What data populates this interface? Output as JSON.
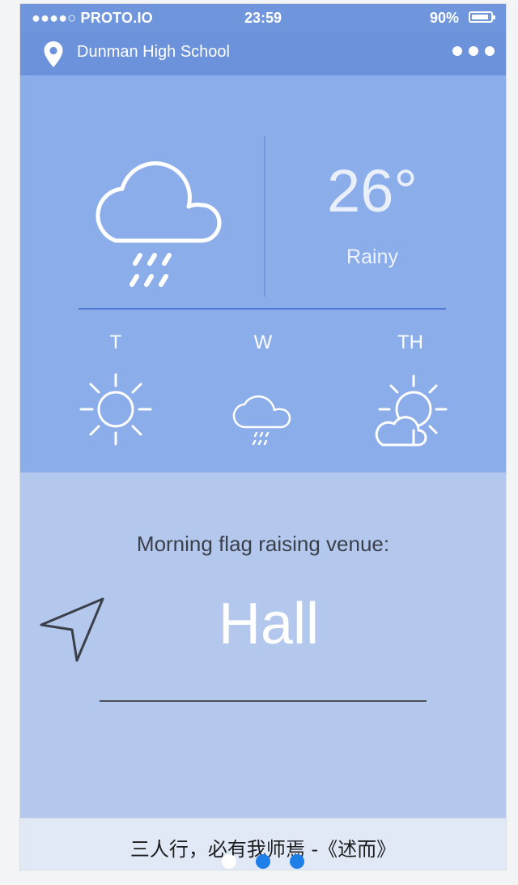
{
  "status_bar": {
    "carrier": "●●●●○ PROTO.IO",
    "time": "23:59",
    "battery": "90%",
    "battery_level": 0.9
  },
  "navbar": {
    "location": "Dunman High School",
    "location_icon": "map-pin-icon",
    "menu_icon": "more-dots-icon"
  },
  "weather": {
    "current": {
      "temperature": "26°",
      "condition": "Rainy",
      "icon": "cloud-rain-icon"
    },
    "forecast": [
      {
        "day": "T",
        "icon": "sun-icon"
      },
      {
        "day": "W",
        "icon": "cloud-rain-icon"
      },
      {
        "day": "TH",
        "icon": "partly-cloudy-icon"
      }
    ]
  },
  "assembly": {
    "title": "Morning flag raising venue:",
    "venue": "Hall",
    "icon": "navigation-arrow-icon"
  },
  "footer": {
    "quote": "三人行，必有我师焉 -《述而》"
  },
  "pager": {
    "count": 3,
    "active_index": 0
  },
  "colors": {
    "status_bar": "#6f96dc",
    "navbar": "#6b92db",
    "weather_panel": "#8badea",
    "info_panel": "#b4c8ee",
    "footer": "#e1e9f7",
    "page_dot_active": "#ffffff",
    "page_dot": "#1e7fe8"
  }
}
